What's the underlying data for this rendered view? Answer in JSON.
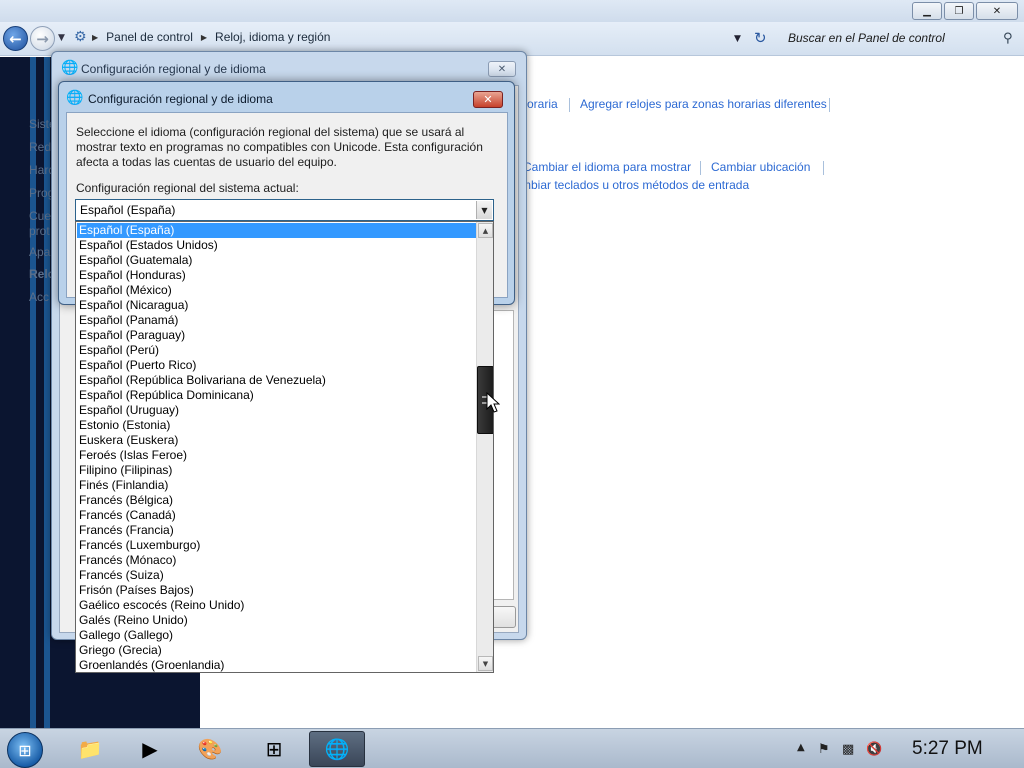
{
  "explorer": {
    "breadcrumb": [
      "Panel de control",
      "Reloj, idioma y región"
    ],
    "search_placeholder": "Buscar en el Panel de control",
    "left_links": [
      "Siste",
      "Red",
      "Hard",
      "Prog",
      "Cue",
      "prot",
      "Apa",
      "Relo",
      "Acc"
    ],
    "links": {
      "row1": [
        "oraria",
        "Agregar relojes para zonas horarias diferentes"
      ],
      "row2": [
        "Cambiar el idioma para mostrar",
        "Cambiar ubicación"
      ],
      "row3": [
        "mbiar teclados u otros métodos de entrada"
      ]
    },
    "window_buttons": {
      "minimize": "▁",
      "maximize": "❐",
      "close": "✕"
    }
  },
  "outer_dialog": {
    "title": "Configuración regional y de idioma",
    "close_glyph": "✕"
  },
  "inner_dialog": {
    "title": "Configuración regional y de idioma",
    "close_glyph": "✕",
    "description": "Seleccione el idioma (configuración regional del sistema) que se usará al mostrar texto en programas no compatibles con Unicode. Esta configuración afecta a todas las cuentas de usuario del equipo.",
    "label": "Configuración regional del sistema actual:",
    "selected_value": "Español (España)"
  },
  "locale_list": {
    "selected_index": 0,
    "items": [
      "Español (España)",
      "Español (Estados Unidos)",
      "Español (Guatemala)",
      "Español (Honduras)",
      "Español (México)",
      "Español (Nicaragua)",
      "Español (Panamá)",
      "Español (Paraguay)",
      "Español (Perú)",
      "Español (Puerto Rico)",
      "Español (República Bolivariana de Venezuela)",
      "Español (República Dominicana)",
      "Español (Uruguay)",
      "Estonio (Estonia)",
      "Euskera (Euskera)",
      "Feroés (Islas Feroe)",
      "Filipino (Filipinas)",
      "Finés (Finlandia)",
      "Francés (Bélgica)",
      "Francés (Canadá)",
      "Francés (Francia)",
      "Francés (Luxemburgo)",
      "Francés (Mónaco)",
      "Francés (Suiza)",
      "Frisón (Países Bajos)",
      "Gaélico escocés (Reino Unido)",
      "Galés (Reino Unido)",
      "Gallego (Gallego)",
      "Griego (Grecia)",
      "Groenlandés (Groenlandia)"
    ]
  },
  "taskbar": {
    "clock": "5:27 PM",
    "apps": [
      {
        "icon": "folder-icon",
        "glyph": "📁"
      },
      {
        "icon": "media-player-icon",
        "glyph": "▶"
      },
      {
        "icon": "paint-icon",
        "glyph": "🎨"
      },
      {
        "icon": "windows-logo-icon",
        "glyph": "⊞"
      },
      {
        "icon": "clock-globe-icon",
        "glyph": "🌐"
      }
    ],
    "tray": [
      "show-hidden-icon",
      "action-center-flag-icon",
      "network-icon",
      "volume-muted-icon"
    ]
  }
}
